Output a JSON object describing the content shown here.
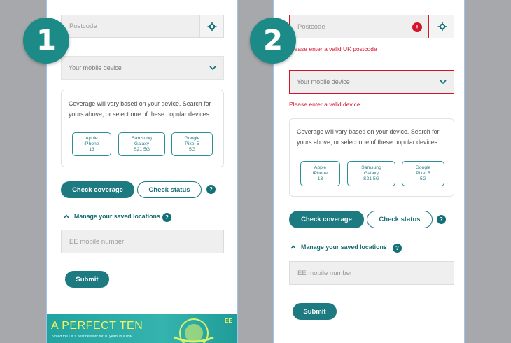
{
  "badges": [
    "1",
    "2"
  ],
  "form": {
    "postcode_placeholder": "Postcode",
    "device_placeholder": "Your mobile device",
    "coverage_info": "Coverage will vary based on your device. Search for yours above, or select one of these popular devices.",
    "devices": [
      "Apple\niPhone\n13",
      "Samsung\nGalaxy\nS21 5G",
      "Google\nPixel 5\n5G"
    ],
    "check_coverage_label": "Check coverage",
    "check_status_label": "Check status",
    "help_glyph": "?",
    "manage_label": "Manage your saved locations",
    "mobile_placeholder": "EE mobile number",
    "submit_label": "Submit"
  },
  "errors": {
    "postcode": "Please enter a valid UK postcode",
    "device": "Please enter a valid device",
    "icon_glyph": "!"
  },
  "banner": {
    "title": "A PERFECT TEN",
    "subtitle": "Voted the UK's best network for 10 years in a row",
    "brand": "EE"
  },
  "colors": {
    "accent": "#1c7a80",
    "error": "#d4142a",
    "background": "#a6a8ab"
  }
}
